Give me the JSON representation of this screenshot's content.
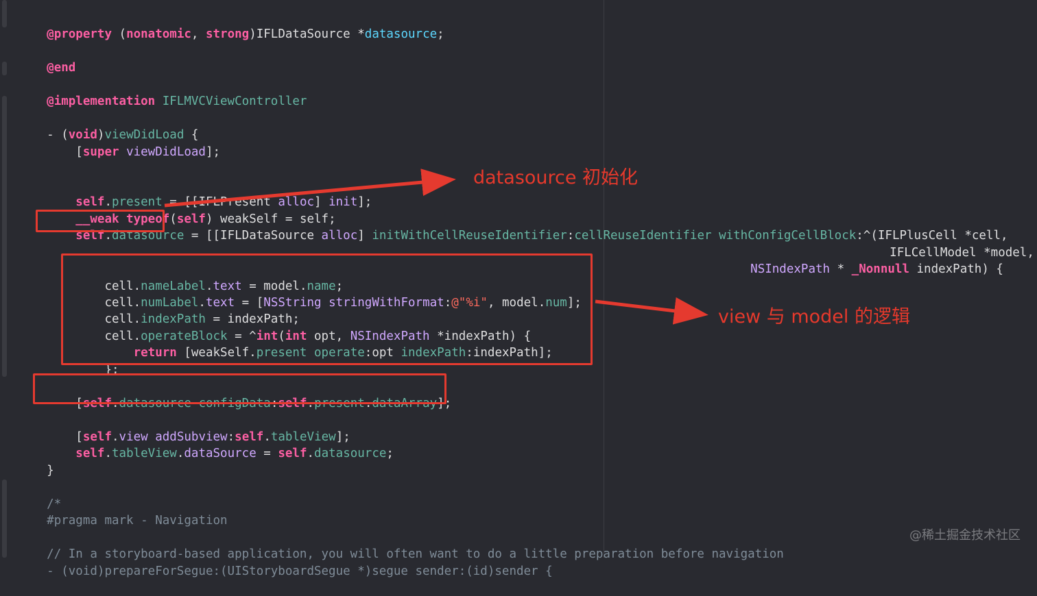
{
  "lines": {
    "l1": {
      "at": "@property",
      "open": " (",
      "nonatomic": "nonatomic",
      "comma": ", ",
      "strong": "strong",
      "close": ")",
      "type": "IFLDataSource",
      "star": " *",
      "var": "datasource",
      "semi": ";"
    },
    "l2": {
      "end": "@end"
    },
    "l3": {
      "impl": "@implementation",
      "name": " IFLMVCViewController"
    },
    "l4": {
      "dash": "- (",
      "void": "void",
      "close": ")",
      "method": "viewDidLoad",
      "brace": " {"
    },
    "l5": {
      "open": "    [",
      "super": "super",
      "method": " viewDidLoad",
      "close": "];"
    },
    "l6": {
      "self": "    self",
      "dot": ".",
      "present": "present",
      "eq": " = [[",
      "cls": "IFLPresent",
      "alloc": " alloc",
      "rb": "] ",
      "init": "init",
      "end": "];"
    },
    "l7": {
      "weak": "    __weak",
      "typeof": " typeof",
      "open": "(",
      "self": "self",
      "rest": ") weakSelf = self;"
    },
    "l8": {
      "self": "    self",
      "dot": ".",
      "ds": "datasource",
      "eq": " = [[",
      "cls": "IFLDataSource",
      "alloc": " alloc",
      "rb": "] ",
      "init": "initWithCellReuseIdentifier",
      "colon": ":",
      "arg": "cellReuseIdentifier",
      "sp": " ",
      "with": "withConfigCellBlock",
      "caret": ":^(",
      "cell": "IFLPlusCell",
      "rest": " *cell,"
    },
    "l9": {
      "model": "IFLCellModel",
      "rest": " *model,"
    },
    "l10": {
      "idx": "NSIndexPath",
      "star": " * ",
      "nonnull": "_Nonnull",
      "rest": " indexPath) {"
    },
    "l11": {
      "a": "        cell.",
      "b": "nameLabel",
      "c": ".",
      "d": "text",
      "e": " = model.",
      "f": "name",
      "g": ";"
    },
    "l12": {
      "a": "        cell.",
      "b": "numLabel",
      "c": ".",
      "d": "text",
      "e": " = [",
      "f": "NSString",
      "g": " stringWithFormat",
      "h": ":",
      "i": "@\"%i\"",
      "j": ", model.",
      "k": "num",
      "l": "];"
    },
    "l13": {
      "a": "        cell.",
      "b": "indexPath",
      "c": " = indexPath;"
    },
    "l14": {
      "a": "        cell.",
      "b": "operateBlock",
      "c": " = ^",
      "d": "int",
      "e": "(",
      "f": "int",
      "g": " opt, ",
      "h": "NSIndexPath",
      "i": " *indexPath) {"
    },
    "l15": {
      "ret": "            return",
      "a": " [weakSelf.",
      "b": "present",
      "c": " operate",
      "d": ":opt ",
      "e": "indexPath",
      "f": ":indexPath];"
    },
    "l16": {
      "a": "        };"
    },
    "l17": {
      "a": "    }];"
    },
    "l18": {
      "a": "    [",
      "self": "self",
      "b": ".",
      "ds": "datasource",
      "c": " configData",
      "d": ":",
      "self2": "self",
      "e": ".",
      "present": "present",
      "f": ".",
      "arr": "dataArray",
      "g": "];"
    },
    "l19": {
      "a": "    [",
      "self": "self",
      "b": ".",
      "view": "view",
      "c": " addSubview",
      "d": ":",
      "self2": "self",
      "e": ".",
      "tv": "tableView",
      "f": "];"
    },
    "l20": {
      "self": "    self",
      "a": ".",
      "tv": "tableView",
      "b": ".",
      "dsrc": "dataSource",
      "c": " = ",
      "self2": "self",
      "d": ".",
      "ds": "datasource",
      "e": ";"
    },
    "l21": {
      "a": "}"
    },
    "l22": {
      "a": "/*"
    },
    "l23": {
      "a": "#pragma mark - Navigation"
    },
    "l24": {
      "a": "// In a storyboard-based application, you will often want to do a little preparation before navigation"
    },
    "l25": {
      "a": "- (void)prepareForSegue:(UIStoryboardSegue *)segue sender:(id)sender {"
    }
  },
  "annotations": {
    "init_label": "datasource 初始化",
    "logic_label": "view 与 model 的逻辑"
  },
  "watermark": "@稀土掘金技术社区",
  "colors": {
    "background": "#292a30",
    "keyword": "#fc5fa3",
    "type": "#d0a8ff",
    "identifier": "#67b7a4",
    "plain": "#dfdfe0",
    "comment": "#7f8c98",
    "string": "#fc6a5d",
    "annotation_red": "#e53a2f"
  }
}
